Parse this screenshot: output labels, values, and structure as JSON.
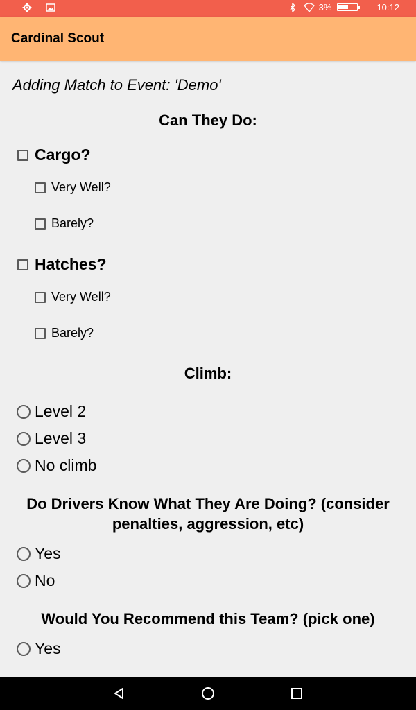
{
  "status_bar": {
    "battery_percent": "3%",
    "time": "10:12",
    "icons": [
      "settings-icon",
      "image-icon",
      "bluetooth-icon",
      "wifi-icon",
      "battery-icon"
    ]
  },
  "app_bar": {
    "title": "Cardinal Scout"
  },
  "form": {
    "subtitle": "Adding Match to Event: 'Demo'",
    "can_they_do": {
      "heading": "Can They Do:",
      "cargo": {
        "label": "Cargo?",
        "very_well": "Very Well?",
        "barely": "Barely?"
      },
      "hatches": {
        "label": "Hatches?",
        "very_well": "Very Well?",
        "barely": "Barely?"
      }
    },
    "climb": {
      "heading": "Climb:",
      "options": [
        "Level 2",
        "Level 3",
        "No climb"
      ]
    },
    "drivers": {
      "heading_line1": "Do Drivers Know What They Are Doing? (consider",
      "heading_line2": "penalties, aggression, etc)",
      "options": [
        "Yes",
        "No"
      ]
    },
    "recommend": {
      "heading": "Would You Recommend this Team? (pick one)",
      "options": [
        "Yes"
      ]
    }
  },
  "colors": {
    "status_bar": "#f25f4c",
    "app_bar": "#ffb573",
    "background": "#efefef",
    "nav_bar": "#000000"
  },
  "nav_bar": {
    "buttons": [
      "back-icon",
      "home-icon",
      "recents-icon"
    ]
  }
}
